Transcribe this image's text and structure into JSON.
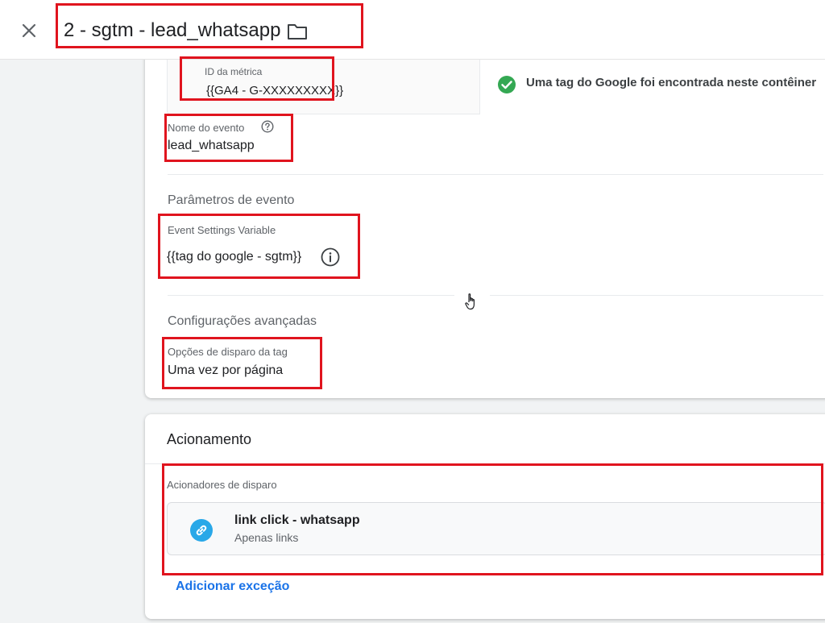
{
  "header": {
    "tag_title": "2 - sgtm - lead_whatsapp",
    "close_icon": "close-icon",
    "folder_icon": "folder-icon"
  },
  "config": {
    "metric_id_label": "ID da métrica",
    "metric_id_value": "{{GA4 - G-XXXXXXXXX}}",
    "google_tag_found": "Uma tag do Google foi encontrada neste contêiner",
    "event_name_label": "Nome do evento",
    "event_name_value": "lead_whatsapp",
    "event_params_title": "Parâmetros de evento",
    "event_settings_label": "Event Settings Variable",
    "event_settings_value": "{{tag do google - sgtm}}",
    "advanced_title": "Configurações avançadas",
    "firing_options_label": "Opções de disparo da tag",
    "firing_options_value": "Uma vez por página"
  },
  "triggering": {
    "title": "Acionamento",
    "triggers_label": "Acionadores de disparo",
    "trigger_name": "link click - whatsapp",
    "trigger_type": "Apenas links",
    "add_exception": "Adicionar exceção"
  },
  "colors": {
    "highlight": "#e0141e",
    "success": "#34a853",
    "trigger_icon": "#29a8e8",
    "link": "#1a73e8"
  }
}
